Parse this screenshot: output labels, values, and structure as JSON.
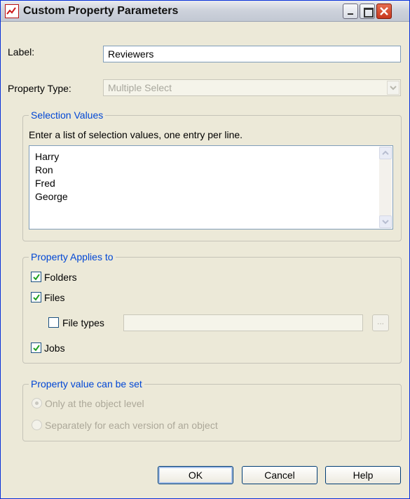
{
  "window": {
    "title": "Custom Property Parameters",
    "accent": "#0046d5",
    "background": "#ECE9D8"
  },
  "form": {
    "label_caption": "Label:",
    "label_value": "Reviewers",
    "property_type_caption": "Property Type:",
    "property_type_value": "Multiple Select"
  },
  "selection_values": {
    "title": "Selection Values",
    "instruction": "Enter a list of selection values, one entry per line.",
    "items": [
      "Harry",
      "Ron",
      "Fred",
      "George"
    ]
  },
  "applies_to": {
    "title": "Property Applies to",
    "folders": {
      "label": "Folders",
      "checked": true
    },
    "files": {
      "label": "Files",
      "checked": true
    },
    "file_types": {
      "label": "File types",
      "checked": false,
      "value": "",
      "browse_label": "..."
    },
    "jobs": {
      "label": "Jobs",
      "checked": true
    }
  },
  "value_set": {
    "title": "Property value can be set",
    "options": [
      {
        "label": "Only at the object level",
        "selected": true
      },
      {
        "label": "Separately for each version of an object",
        "selected": false
      }
    ]
  },
  "buttons": {
    "ok": "OK",
    "cancel": "Cancel",
    "help": "Help"
  }
}
